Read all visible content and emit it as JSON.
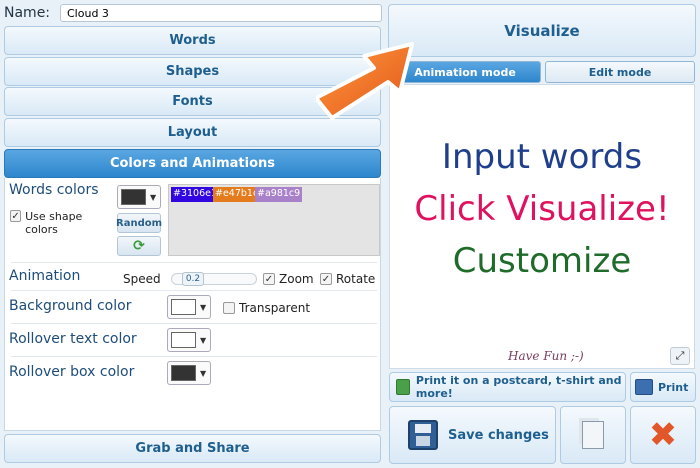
{
  "name_field": {
    "label": "Name:",
    "value": "Cloud 3"
  },
  "sections": {
    "words": "Words",
    "shapes": "Shapes",
    "fonts": "Fonts",
    "layout": "Layout",
    "colors_animations": "Colors and Animations",
    "grab_share": "Grab and Share"
  },
  "colors": {
    "words_colors_label": "Words colors",
    "use_shape_colors_label": "Use shape colors",
    "random_label": "Random",
    "swatch_color": "#333333",
    "chips": [
      {
        "text": "#3106e1",
        "color": "#3106e1"
      },
      {
        "text": "#e47b1c",
        "color": "#e47b1c"
      },
      {
        "text": "#a981c9",
        "color": "#a981c9"
      }
    ],
    "animation_label": "Animation",
    "speed_label": "Speed",
    "speed_value": "0.2",
    "zoom_label": "Zoom",
    "rotate_label": "Rotate",
    "background_label": "Background color",
    "background_color": "#ffffff",
    "transparent_label": "Transparent",
    "rollover_text_label": "Rollover text color",
    "rollover_text_color": "#ffffff",
    "rollover_box_label": "Rollover box color",
    "rollover_box_color": "#333333"
  },
  "right": {
    "visualize_label": "Visualize",
    "tab_animation": "Animation mode",
    "tab_edit": "Edit mode",
    "cloud_line1": "Input words",
    "cloud_line2": "Click Visualize!",
    "cloud_line3": "Customize",
    "cloud_colors": [
      "#1f3f8c",
      "#e0115f",
      "#1f6b2a"
    ],
    "have_fun": "Have Fun ;-)",
    "print_postcard_label": "Print it on a postcard, t-shirt and more!",
    "print_label": "Print",
    "save_label": "Save changes"
  },
  "icons": {
    "expand": "expand-icon",
    "refresh": "refresh-icon",
    "postcard": "postcard-icon",
    "printer": "printer-icon",
    "save": "floppy-disk-icon",
    "copy": "copy-icon",
    "delete": "delete-x-icon",
    "hint_arrow": "arrow-icon"
  }
}
